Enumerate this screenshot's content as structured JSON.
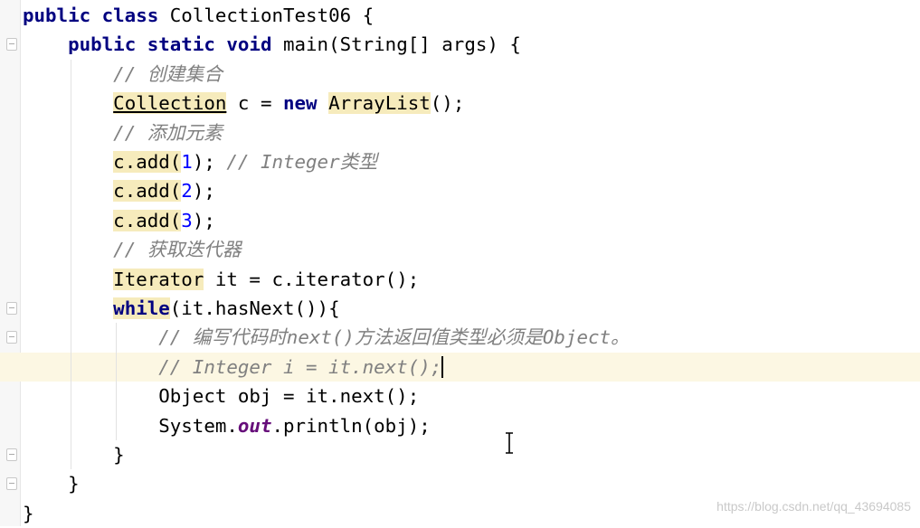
{
  "editor": {
    "current_line": 13,
    "fold_lines": [
      2,
      11,
      12,
      13,
      16,
      17
    ],
    "lines": [
      [
        {
          "t": "public class ",
          "k": "kw"
        },
        {
          "t": "CollectionTest06 {",
          "k": ""
        }
      ],
      [
        {
          "t": "    "
        },
        {
          "t": "public static void ",
          "k": "kw"
        },
        {
          "t": "main(String[] args) {",
          "k": ""
        }
      ],
      [
        {
          "t": "        "
        },
        {
          "t": "// 创建集合",
          "k": "cm"
        }
      ],
      [
        {
          "t": "        "
        },
        {
          "t": "Collection",
          "k": "hl ul"
        },
        {
          "t": " c = "
        },
        {
          "t": "new",
          "k": "kw"
        },
        {
          "t": " "
        },
        {
          "t": "ArrayList",
          "k": "hl"
        },
        {
          "t": "();"
        }
      ],
      [
        {
          "t": "        "
        },
        {
          "t": "// 添加元素",
          "k": "cm"
        }
      ],
      [
        {
          "t": "        "
        },
        {
          "t": "c.add(",
          "k": "hl"
        },
        {
          "t": "1",
          "k": "num"
        },
        {
          "t": "); "
        },
        {
          "t": "// Integer类型",
          "k": "cm"
        }
      ],
      [
        {
          "t": "        "
        },
        {
          "t": "c.add(",
          "k": "hl"
        },
        {
          "t": "2",
          "k": "num"
        },
        {
          "t": ");"
        }
      ],
      [
        {
          "t": "        "
        },
        {
          "t": "c.add(",
          "k": "hl"
        },
        {
          "t": "3",
          "k": "num"
        },
        {
          "t": ");"
        }
      ],
      [
        {
          "t": "        "
        },
        {
          "t": "// 获取迭代器",
          "k": "cm"
        }
      ],
      [
        {
          "t": "        "
        },
        {
          "t": "Iterator",
          "k": "hl"
        },
        {
          "t": " it = c.iterator();"
        }
      ],
      [
        {
          "t": "        "
        },
        {
          "t": "while",
          "k": "kw hl"
        },
        {
          "t": "(it.hasNext()){"
        }
      ],
      [
        {
          "t": "            "
        },
        {
          "t": "// 编写代码时next()方法返回值类型必须是Object。",
          "k": "cm"
        }
      ],
      [
        {
          "t": "            "
        },
        {
          "t": "// Integer i = it.next();",
          "k": "cm"
        }
      ],
      [
        {
          "t": "            "
        },
        {
          "t": "Object obj = it.next();"
        }
      ],
      [
        {
          "t": "            "
        },
        {
          "t": "System."
        },
        {
          "t": "out",
          "k": "sf"
        },
        {
          "t": ".println(obj);"
        }
      ],
      [
        {
          "t": "        "
        },
        {
          "t": "}"
        }
      ],
      [
        {
          "t": "    "
        },
        {
          "t": "}"
        }
      ],
      [
        {
          "t": "}"
        }
      ]
    ]
  },
  "watermark": "https://blog.csdn.net/qq_43694085"
}
